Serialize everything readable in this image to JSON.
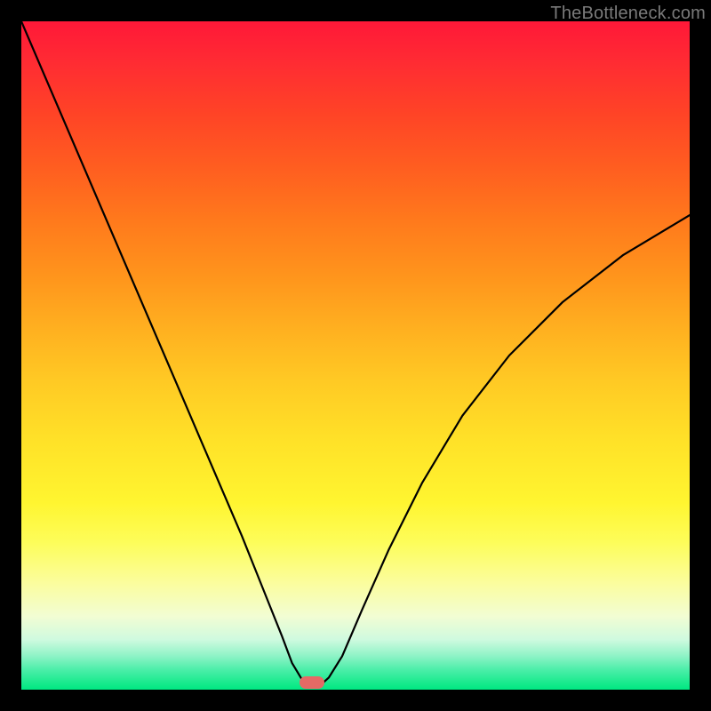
{
  "watermark": "TheBottleneck.com",
  "marker": {
    "x_pct": 43.5,
    "y_pct": 99.0
  },
  "colors": {
    "background": "#000000",
    "marker": "#e56a65",
    "curve": "#000000",
    "gradient_top": "#ff1838",
    "gradient_mid": "#ffe228",
    "gradient_bottom": "#00e882",
    "watermark": "#7a7a7a"
  },
  "chart_data": {
    "type": "line",
    "title": "",
    "xlabel": "",
    "ylabel": "",
    "xlim": [
      0,
      100
    ],
    "ylim": [
      0,
      100
    ],
    "grid": false,
    "legend": false,
    "series": [
      {
        "name": "bottleneck-curve",
        "x": [
          0,
          3,
          6,
          9,
          12,
          15,
          18,
          21,
          24,
          27,
          30,
          33,
          35,
          37,
          39,
          40.5,
          42,
          43,
          44,
          45,
          46,
          48,
          51,
          55,
          60,
          66,
          73,
          81,
          90,
          100
        ],
        "y": [
          100,
          93,
          86,
          79,
          72,
          65,
          58,
          51,
          44,
          37,
          30,
          23,
          18,
          13,
          8,
          4,
          1.5,
          0.8,
          0.8,
          0.9,
          1.8,
          5,
          12,
          21,
          31,
          41,
          50,
          58,
          65,
          71
        ]
      }
    ],
    "annotations": [
      {
        "type": "marker",
        "shape": "rounded-rect",
        "x": 43.5,
        "y": 1.0,
        "color": "#e56a65"
      }
    ],
    "background": "red-yellow-green vertical gradient, green at bottom"
  }
}
